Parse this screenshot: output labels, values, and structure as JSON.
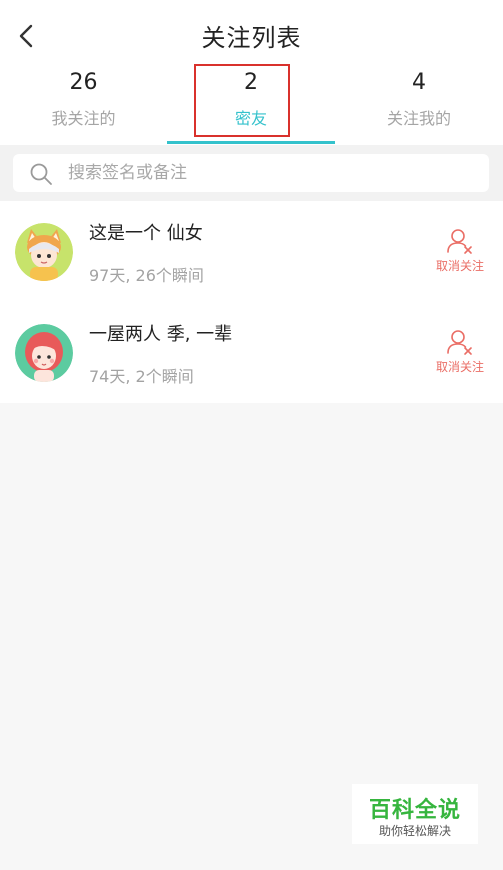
{
  "header": {
    "title": "关注列表",
    "back_icon": "chevron-left-icon"
  },
  "tabs": [
    {
      "count": "26",
      "label": "我关注的",
      "active": false
    },
    {
      "count": "2",
      "label": "密友",
      "active": true
    },
    {
      "count": "4",
      "label": "关注我的",
      "active": false
    }
  ],
  "search": {
    "placeholder": "搜索签名或备注",
    "icon": "search-icon"
  },
  "friends": [
    {
      "name": "这是一个   仙女",
      "meta": "97天, 26个瞬间",
      "action": "取消关注",
      "avatar": "fox-girl-avatar"
    },
    {
      "name": "一屋两人    季, 一辈",
      "meta": "74天, 2个瞬间",
      "action": "取消关注",
      "avatar": "red-hair-girl-avatar"
    }
  ],
  "watermark": {
    "title": "百科全说",
    "subtitle": "助你轻松解决"
  },
  "colors": {
    "accent": "#34c2cc",
    "highlight": "#d9312c",
    "unfollow": "#ea6e66",
    "watermark": "#36b53e"
  }
}
